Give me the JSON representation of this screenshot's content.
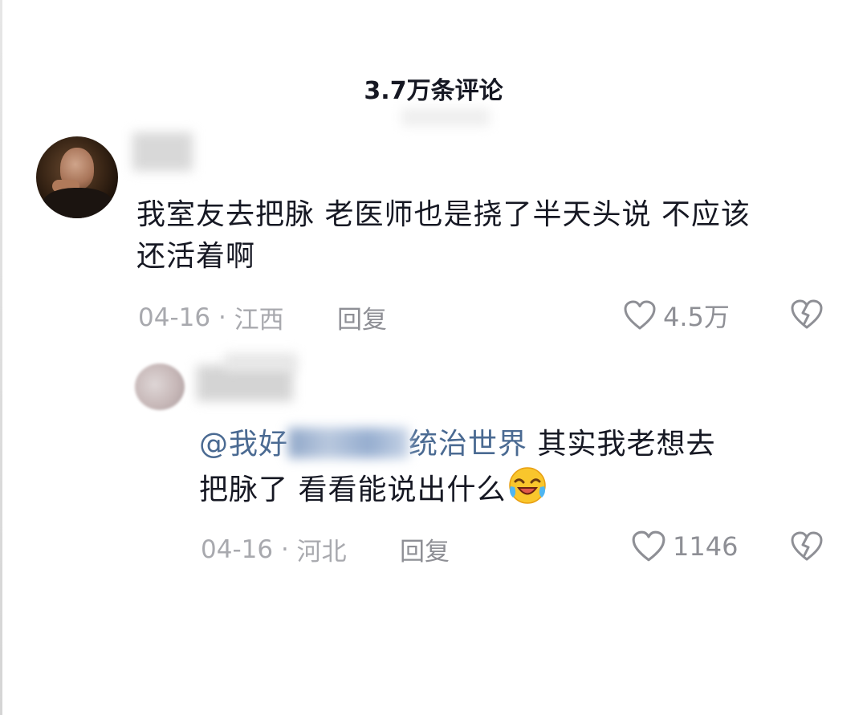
{
  "header": {
    "title": "3.7万条评论"
  },
  "comments": [
    {
      "text": "我室友去把脉 老医师也是挠了半天头说 不应该还活着啊",
      "text_line1": "我室友去把脉 老医师也是挠了半天头说 不应该",
      "text_line2": "还活着啊",
      "date": "04-16",
      "location": "江西",
      "reply_label": "回复",
      "likes": "4.5万"
    }
  ],
  "replies": [
    {
      "mention_start": "@我好",
      "mention_end": "统治世界",
      "text_line1": " 其实我老想去",
      "text_line2": "把脉了 看看能说出什么",
      "emoji": "laughing-crying-emoji",
      "date": "04-16",
      "location": "河北",
      "reply_label": "回复",
      "likes": "1146"
    }
  ],
  "icons": {
    "like": "heart-outline-icon",
    "dislike": "broken-heart-icon"
  },
  "colors": {
    "text": "#161823",
    "meta": "#a8a9ae",
    "mention": "#4a6a92",
    "icon": "#8e8f95"
  }
}
